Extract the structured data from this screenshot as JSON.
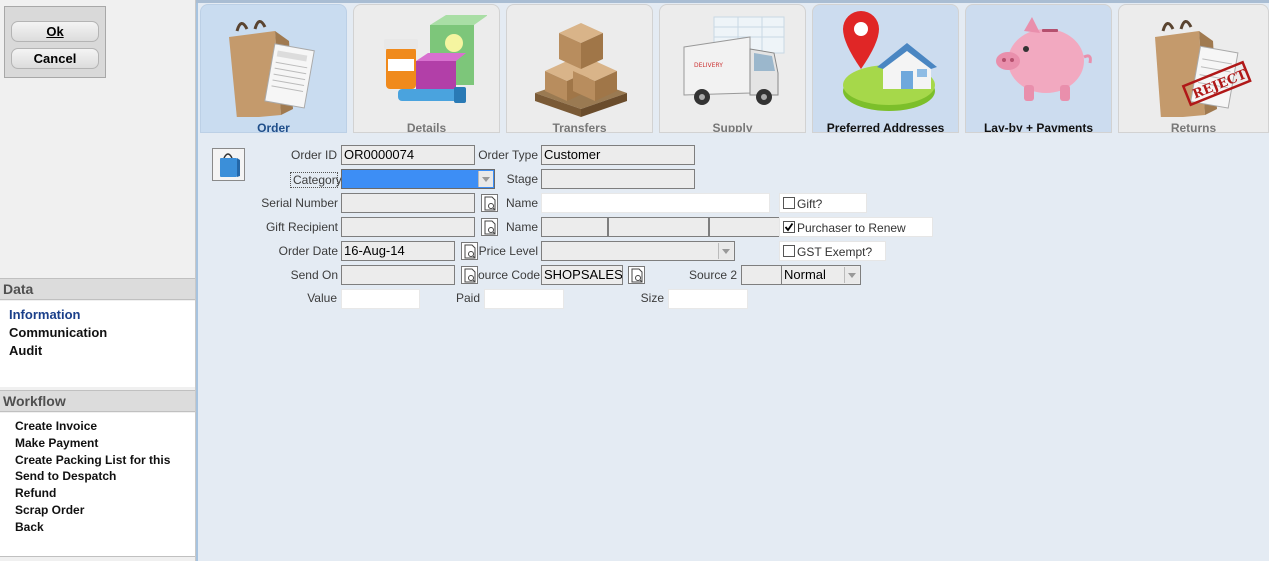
{
  "buttons": {
    "ok": "Ok",
    "cancel": "Cancel"
  },
  "data_section": {
    "title": "Data",
    "items": [
      {
        "label": "Information",
        "active": true
      },
      {
        "label": "Communication",
        "active": false
      },
      {
        "label": "Audit",
        "active": false
      }
    ]
  },
  "workflow_section": {
    "title": "Workflow",
    "items": [
      {
        "label": "Create Invoice"
      },
      {
        "label": "Make Payment"
      },
      {
        "label": "Create Packing List for this"
      },
      {
        "label": "Send to Despatch"
      },
      {
        "label": "Refund"
      },
      {
        "label": "Scrap Order"
      },
      {
        "label": "Back"
      }
    ]
  },
  "tabs": [
    {
      "label": "Order",
      "icon": "shopping-bag-icon",
      "active": true
    },
    {
      "label": "Details",
      "icon": "products-icon",
      "active": false
    },
    {
      "label": "Transfers",
      "icon": "boxes-pallet-icon",
      "active": false
    },
    {
      "label": "Supply",
      "icon": "delivery-truck-icon",
      "active": false
    },
    {
      "label": "Preferred Addresses",
      "icon": "house-location-icon",
      "active": false
    },
    {
      "label": "Lay-by + Payments",
      "icon": "piggy-bank-icon",
      "active": false
    },
    {
      "label": "Returns",
      "icon": "reject-bag-icon",
      "active": false
    }
  ],
  "form": {
    "order_id_label": "Order ID",
    "order_id": "OR0000074",
    "order_type_label": "Order Type",
    "order_type": "Customer",
    "category_label": "Category",
    "category": "",
    "stage_label": "Stage",
    "stage": "",
    "serial_number_label": "Serial Number",
    "serial_number": "",
    "name_label": "Name",
    "name": "",
    "gift_label": "Gift?",
    "gift_checked": false,
    "gift_recipient_label": "Gift Recipient",
    "gift_recipient": "",
    "name2_label": "Name",
    "purchaser_renew_label": "Purchaser to Renew",
    "purchaser_renew_checked": true,
    "order_date_label": "Order Date",
    "order_date": "16-Aug-14",
    "price_level_label": "Price Level",
    "price_level": "",
    "gst_exempt_label": "GST Exempt?",
    "gst_exempt_checked": false,
    "send_on_label": "Send On",
    "send_on": "",
    "source_code_label": "ource Code",
    "source_code": "SHOPSALES",
    "source2_label": "Source 2",
    "source2": "",
    "priority": "Normal",
    "value_label": "Value",
    "value": "",
    "paid_label": "Paid",
    "paid": "",
    "size_label": "Size",
    "size": ""
  },
  "colors": {
    "accent": "#1f4e8a",
    "form_bg": "#e4ebf3",
    "selected_field": "#3d8ef5"
  }
}
